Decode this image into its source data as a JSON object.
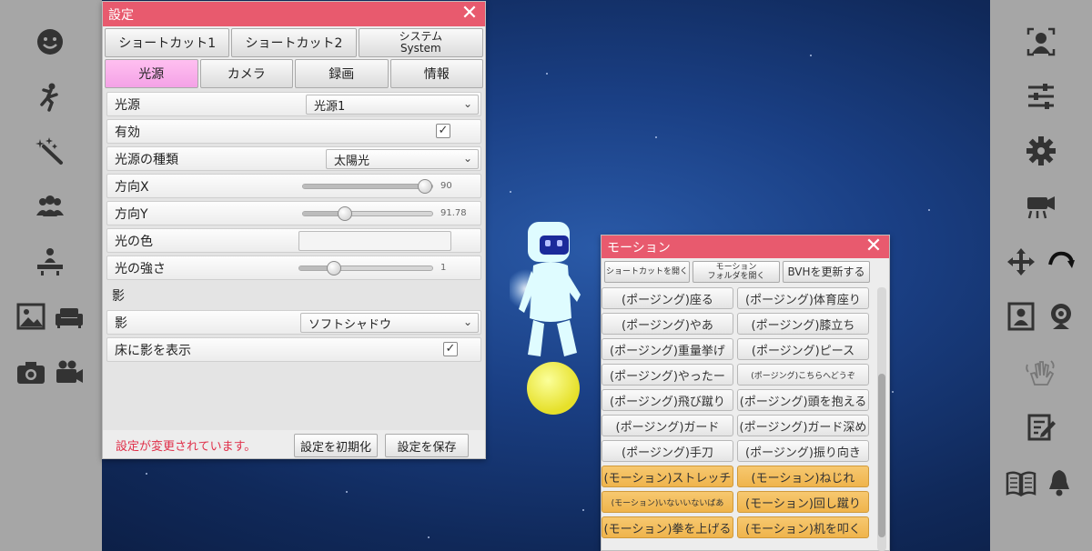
{
  "settings": {
    "title": "設定",
    "tabs_row1": [
      "ショートカット1",
      "ショートカット2"
    ],
    "system_tab": {
      "line1": "システム",
      "line2": "System"
    },
    "tabs_row2": [
      "光源",
      "カメラ",
      "録画",
      "情報"
    ],
    "rows": {
      "light_source": {
        "label": "光源",
        "value": "光源1"
      },
      "enabled": {
        "label": "有効",
        "checked": "✓"
      },
      "light_type": {
        "label": "光源の種類",
        "value": "太陽光"
      },
      "direction_x": {
        "label": "方向X",
        "value": "90",
        "fraction": 1.0
      },
      "direction_y": {
        "label": "方向Y",
        "value": "91.78",
        "fraction": 0.3
      },
      "light_color": {
        "label": "光の色"
      },
      "light_intensity": {
        "label": "光の強さ",
        "value": "1",
        "fraction": 0.23
      },
      "shadow_section": "影",
      "shadow": {
        "label": "影",
        "value": "ソフトシャドウ"
      },
      "floor_shadow": {
        "label": "床に影を表示",
        "checked": "✓"
      }
    },
    "footer": {
      "message": "設定が変更されています。",
      "reset_label": "設定を初期化",
      "save_label": "設定を保存"
    }
  },
  "motion": {
    "title": "モーション",
    "toolbar": {
      "open_shortcut": "ショートカットを開く",
      "open_folder_line1": "モーション",
      "open_folder_line2": "フォルダを開く",
      "update_bvh": "BVHを更新する"
    },
    "buttons": [
      {
        "label": "(ポージング)座る",
        "kind": "posing"
      },
      {
        "label": "(ポージング)体育座り",
        "kind": "posing"
      },
      {
        "label": "(ポージング)やあ",
        "kind": "posing"
      },
      {
        "label": "(ポージング)膝立ち",
        "kind": "posing"
      },
      {
        "label": "(ポージング)重量挙げ",
        "kind": "posing"
      },
      {
        "label": "(ポージング)ピース",
        "kind": "posing"
      },
      {
        "label": "(ポージング)やったー",
        "kind": "posing"
      },
      {
        "label": "(ポージング)こちらへどうぞ",
        "kind": "posing-small"
      },
      {
        "label": "(ポージング)飛び蹴り",
        "kind": "posing"
      },
      {
        "label": "(ポージング)頭を抱える",
        "kind": "posing"
      },
      {
        "label": "(ポージング)ガード",
        "kind": "posing"
      },
      {
        "label": "(ポージング)ガード深め",
        "kind": "posing"
      },
      {
        "label": "(ポージング)手刀",
        "kind": "posing"
      },
      {
        "label": "(ポージング)振り向き",
        "kind": "posing"
      },
      {
        "label": "(モーション)ストレッチ",
        "kind": "motion"
      },
      {
        "label": "(モーション)ねじれ",
        "kind": "motion"
      },
      {
        "label": "(モーション)いないいないばあ",
        "kind": "motion-small"
      },
      {
        "label": "(モーション)回し蹴り",
        "kind": "motion"
      },
      {
        "label": "(モーション)拳を上げる",
        "kind": "motion"
      },
      {
        "label": "(モーション)机を叩く",
        "kind": "motion"
      }
    ]
  },
  "left_sidebar_icons": [
    "smile-icon",
    "dance-icon",
    "magic-wand-icon",
    "group-icon",
    "stage-icon",
    "image-icon",
    "sofa-icon",
    "camera-icon",
    "video-camera-icon"
  ],
  "right_sidebar_icons": [
    "face-tracking-icon",
    "sliders-icon",
    "gear-icon",
    "movie-camera-icon",
    "move-icon",
    "rotate-icon",
    "portrait-icon",
    "webcam-icon",
    "wave-hand-icon",
    "edit-icon",
    "book-icon",
    "bell-icon"
  ],
  "colors": {
    "header": "#e85a6e",
    "active_tab": "#f4a2e6",
    "motion_button": "#efb44c",
    "sidebar": "#a6a6a6"
  }
}
